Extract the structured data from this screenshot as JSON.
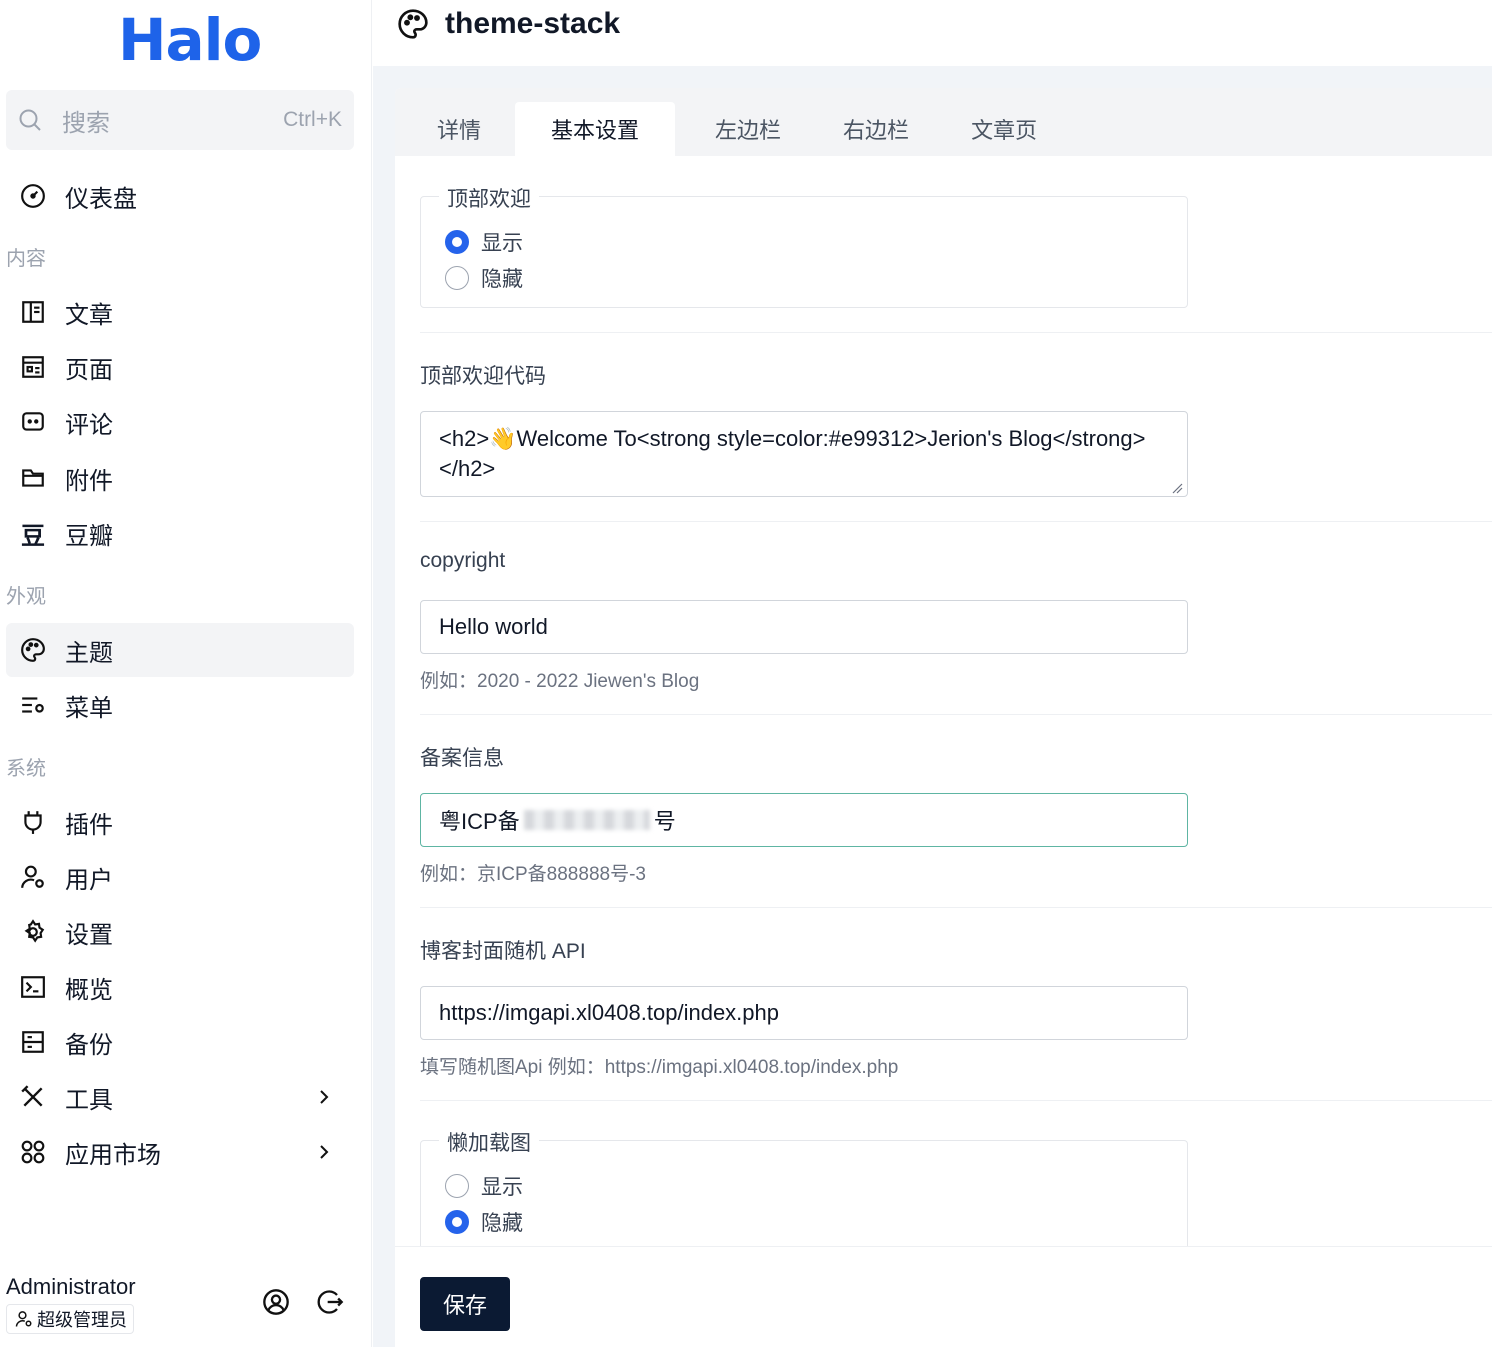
{
  "app": {
    "logo": "Halo"
  },
  "search": {
    "placeholder": "搜索",
    "shortcut": "Ctrl+K"
  },
  "nav": {
    "dashboard": "仪表盘",
    "sections": {
      "content": "内容",
      "appearance": "外观",
      "system": "系统"
    },
    "content_items": [
      "文章",
      "页面",
      "评论",
      "附件",
      "豆瓣"
    ],
    "appearance_items": [
      "主题",
      "菜单"
    ],
    "system_items": [
      "插件",
      "用户",
      "设置",
      "概览",
      "备份",
      "工具",
      "应用市场"
    ]
  },
  "user": {
    "name": "Administrator",
    "role": "超级管理员"
  },
  "header": {
    "title": "theme-stack"
  },
  "tabs": [
    {
      "label": "详情",
      "active": false
    },
    {
      "label": "基本设置",
      "active": true
    },
    {
      "label": "左边栏",
      "active": false
    },
    {
      "label": "右边栏",
      "active": false
    },
    {
      "label": "文章页",
      "active": false
    }
  ],
  "form": {
    "top_welcome": {
      "legend": "顶部欢迎",
      "options": [
        "显示",
        "隐藏"
      ],
      "selected": "显示"
    },
    "top_welcome_code": {
      "label": "顶部欢迎代码",
      "value": "<h2>👋Welcome To<strong style=color:#e99312>Jerion's Blog</strong></h2>"
    },
    "copyright": {
      "label": "copyright",
      "value": "Hello world",
      "help": "例如：2020 - 2022 Jiewen's Blog"
    },
    "icp": {
      "label": "备案信息",
      "value_prefix": "粤ICP备",
      "value_suffix": "号",
      "help": "例如：京ICP备888888号-3"
    },
    "cover_api": {
      "label": "博客封面随机 API",
      "value": "https://imgapi.xl0408.top/index.php",
      "help": "填写随机图Api 例如：https://imgapi.xl0408.top/index.php"
    },
    "lazy_load": {
      "legend": "懒加载图",
      "options": [
        "显示",
        "隐藏"
      ],
      "selected": "隐藏"
    },
    "save_label": "保存"
  },
  "colors": {
    "brand": "#1e63e9",
    "radio_on": "#2563eb",
    "save_bg": "#0b1a33",
    "focus_border": "#5eb5a3"
  }
}
